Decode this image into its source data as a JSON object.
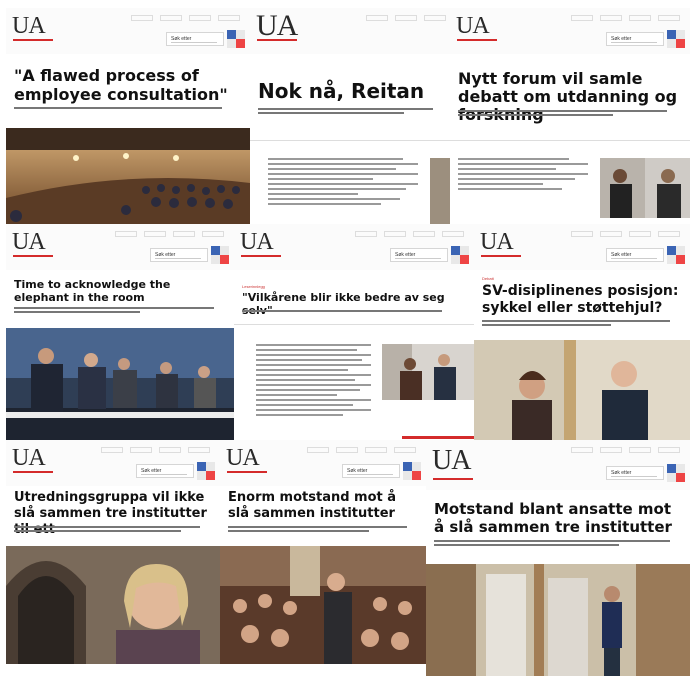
{
  "brand": {
    "logo": "UA",
    "search_label": "Søk etter",
    "accent": "#d42b2b"
  },
  "tiles": [
    {
      "title": "\"A flawed process of employee consultation\"",
      "kicker": ""
    },
    {
      "title": "Nok nå, Reitan",
      "kicker": ""
    },
    {
      "title": "Nytt forum vil samle debatt om utdanning og forskning",
      "kicker": ""
    },
    {
      "title": "Time to acknowledge the elephant in the room",
      "kicker": ""
    },
    {
      "title": "\"Vilkårene blir ikke bedre av seg selv\"",
      "kicker": "Leserinnlegg"
    },
    {
      "title": "SV-disiplinenes posisjon: sykkel eller støttehjul?",
      "kicker": "Debatt"
    },
    {
      "title": "Utredningsgruppa vil ikke slå sammen tre institutter til ett",
      "kicker": ""
    },
    {
      "title": "Enorm motstand mot å slå sammen institutter",
      "kicker": ""
    },
    {
      "title": "Motstand blant ansatte mot å slå sammen tre institutter",
      "kicker": ""
    }
  ],
  "icons": [
    "facebook-icon",
    "twitter-icon",
    "linkedin-icon",
    "email-icon"
  ]
}
